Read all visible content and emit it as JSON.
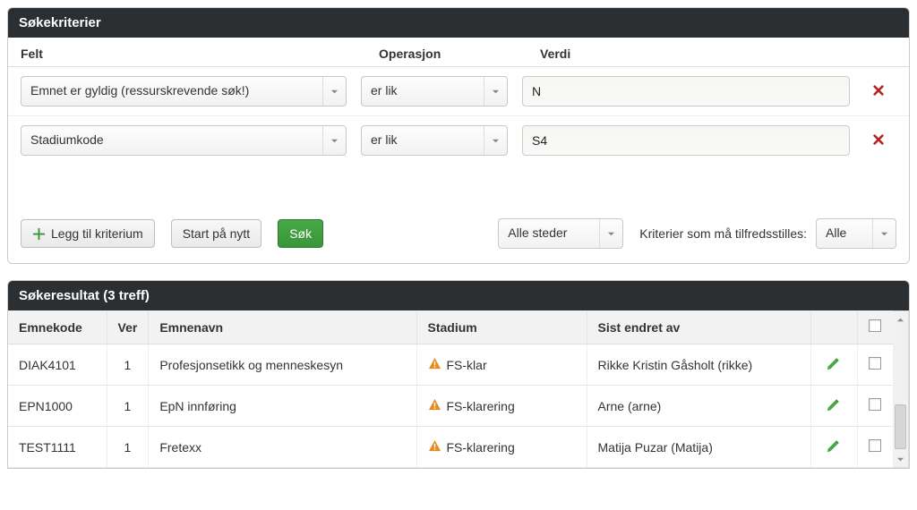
{
  "criteria": {
    "panel_title": "Søkekriterier",
    "headers": {
      "felt": "Felt",
      "operasjon": "Operasjon",
      "verdi": "Verdi"
    },
    "rows": [
      {
        "felt": "Emnet er gyldig (ressurskrevende søk!)",
        "op": "er lik",
        "verdi": "N"
      },
      {
        "felt": "Stadiumkode",
        "op": "er lik",
        "verdi": "S4"
      }
    ],
    "buttons": {
      "add": "Legg til kriterium",
      "restart": "Start på nytt",
      "search": "Søk"
    },
    "place_select": "Alle steder",
    "match_label": "Kriterier som må tilfredsstilles:",
    "match_select": "Alle"
  },
  "results": {
    "panel_title": "Søkeresultat (3 treff)",
    "headers": {
      "emnekode": "Emnekode",
      "ver": "Ver",
      "emnenavn": "Emnenavn",
      "stadium": "Stadium",
      "sistendret": "Sist endret av"
    },
    "rows": [
      {
        "emnekode": "DIAK4101",
        "ver": "1",
        "emnenavn": "Profesjonsetikk og menneskesyn",
        "stadium": "FS-klar",
        "sistendret": "Rikke Kristin Gåsholt (rikke)"
      },
      {
        "emnekode": "EPN1000",
        "ver": "1",
        "emnenavn": "EpN innføring",
        "stadium": "FS-klarering",
        "sistendret": "Arne (arne)"
      },
      {
        "emnekode": "TEST1111",
        "ver": "1",
        "emnenavn": "Fretexx",
        "stadium": "FS-klarering",
        "sistendret": "Matija Puzar (Matija)"
      }
    ]
  }
}
